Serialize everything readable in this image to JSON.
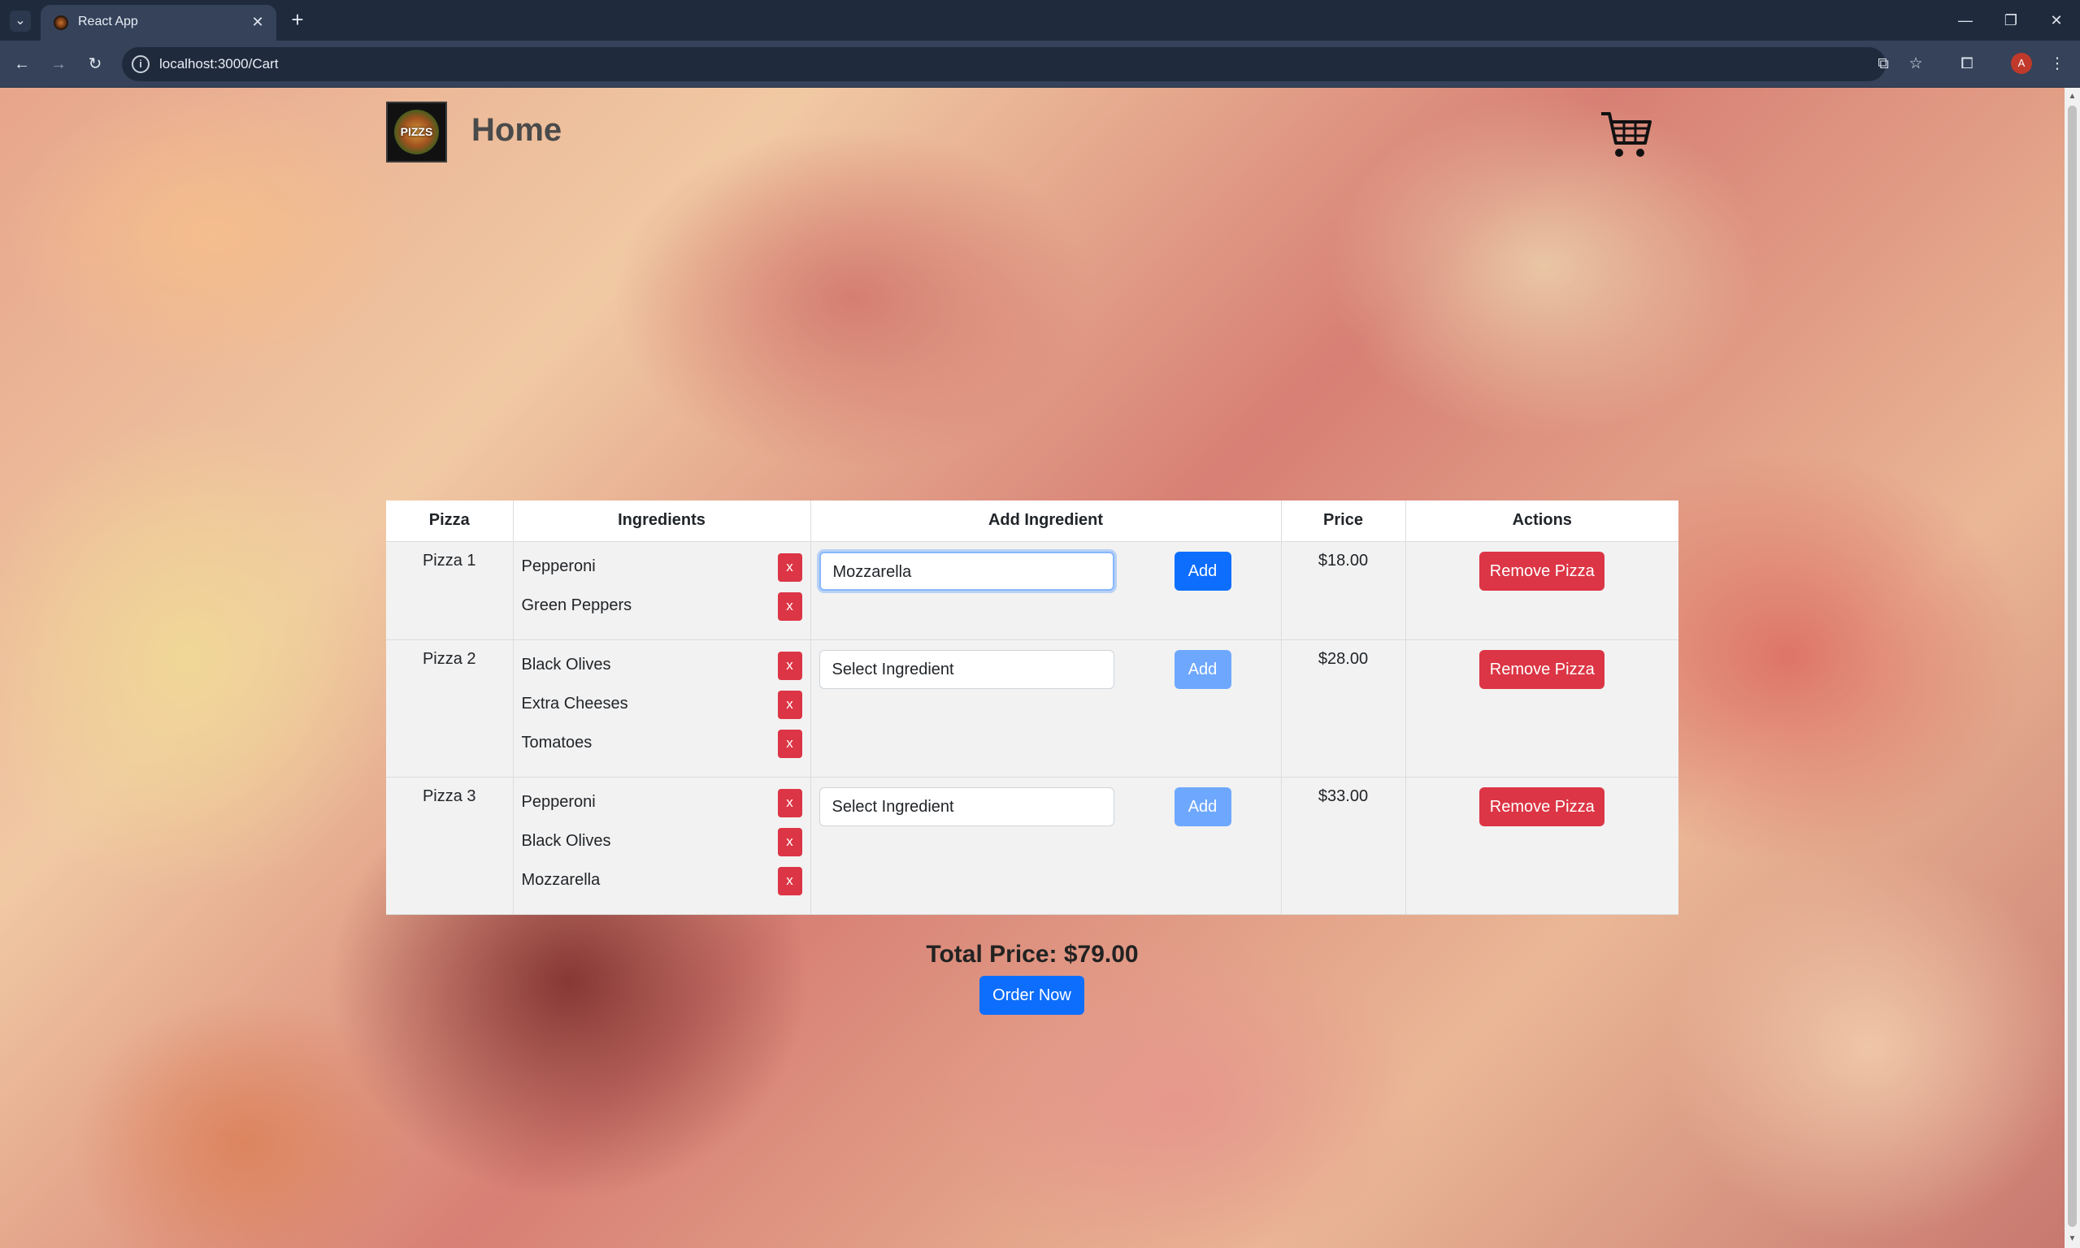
{
  "browser": {
    "tab_title": "React App",
    "url": "localhost:3000/Cart",
    "profile_initial": "A"
  },
  "nav": {
    "home_label": "Home",
    "logo_text": "PIZZS"
  },
  "table": {
    "headers": [
      "Pizza",
      "Ingredients",
      "Add Ingredient",
      "Price",
      "Actions"
    ],
    "rows": [
      {
        "name": "Pizza 1",
        "ingredients": [
          "Pepperoni",
          "Green Peppers"
        ],
        "input_value": "Mozzarella",
        "price": "$18.00"
      },
      {
        "name": "Pizza 2",
        "ingredients": [
          "Black Olives",
          "Extra Cheeses",
          "Tomatoes"
        ],
        "input_value": "Select Ingredient",
        "price": "$28.00"
      },
      {
        "name": "Pizza 3",
        "ingredients": [
          "Pepperoni",
          "Black Olives",
          "Mozzarella"
        ],
        "input_value": "Select Ingredient",
        "price": "$33.00"
      }
    ],
    "remove_ing_label": "x",
    "add_label": "Add",
    "remove_pizza_label": "Remove Pizza"
  },
  "summary": {
    "total": "Total Price: $79.00",
    "order_label": "Order Now"
  },
  "colors": {
    "primary": "#0d6efd",
    "danger": "#dc3545",
    "chrome": "#35425a"
  }
}
